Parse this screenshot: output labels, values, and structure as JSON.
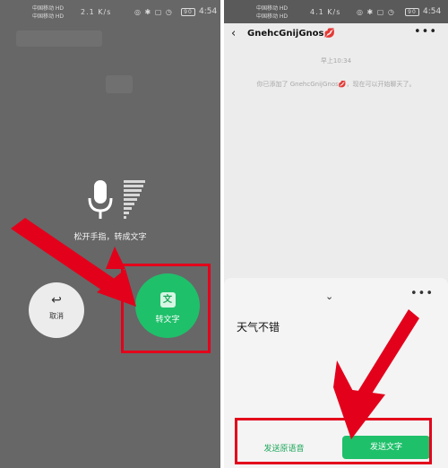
{
  "left_screen": {
    "status": {
      "carrier1": "中国移动 HD",
      "carrier2": "中国移动 HD",
      "net_speed": "2.1 K/s",
      "icons": "◎ ✱ ▢ ◷",
      "battery": "90",
      "time": "4:54"
    },
    "release_hint": "松开手指，转成文字",
    "cancel": {
      "icon": "↩",
      "label": "取消"
    },
    "convert": {
      "icon": "文",
      "label": "转文字"
    }
  },
  "right_screen": {
    "status": {
      "carrier1": "中国移动 HD",
      "carrier2": "中国移动 HD",
      "net_speed": "4.1 K/s",
      "icons": "◎ ✱ ▢ ◷",
      "battery": "90",
      "time": "4:54"
    },
    "header": {
      "back_icon": "‹",
      "title": "GnehcGnijGnos💋",
      "more_icon": "•••"
    },
    "timestamp": "早上10:34",
    "system_message": "你已添加了 GnehcGnijGnos💋，现在可以开始聊天了。",
    "sheet": {
      "chevron_icon": "⌄",
      "more_icon": "•••",
      "transcribed_text": "天气不错",
      "send_voice_label": "发送原语音",
      "send_text_label": "发送文字"
    }
  },
  "colors": {
    "accent_green": "#1fc06a",
    "annotation_red": "#e3001b",
    "overlay_gray": "#676767"
  }
}
